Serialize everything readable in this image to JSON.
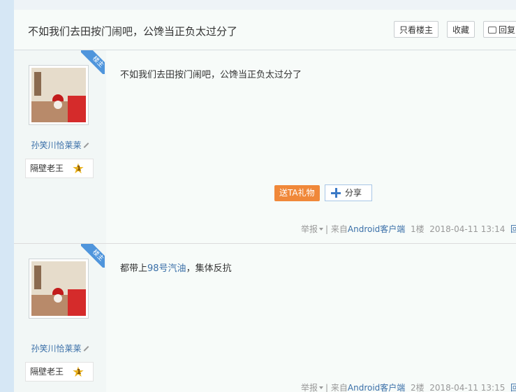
{
  "thread": {
    "title": "不如我们去田按门闹吧，公馋当正负太过分了",
    "only_op_label": "只看楼主",
    "favorite_label": "收藏",
    "reply_label": "回复"
  },
  "posts": [
    {
      "ribbon": "楼主",
      "username": "孙笑川恰莱莱",
      "badge_title": "隔壁老王",
      "badge_level": "1",
      "content": "不如我们去田按门闹吧，公馋当正负太过分了",
      "gift_label": "送TA礼物",
      "share_label": "分享",
      "report_label": "举报",
      "separator": "|",
      "source_prefix": "来自",
      "source_client": "Android客户端",
      "floor": "1楼",
      "time": "2018-04-11 13:14",
      "reply_label": "回复"
    },
    {
      "ribbon": "楼主",
      "username": "孙笑川恰莱莱",
      "badge_title": "隔壁老王",
      "badge_level": "1",
      "content_prefix": "都带上",
      "content_link": "98号汽油",
      "content_suffix": "，集体反抗",
      "report_label": "举报",
      "separator": "|",
      "source_prefix": "来自",
      "source_client": "Android客户端",
      "floor": "2楼",
      "time": "2018-04-11 13:15",
      "reply_label": "回复"
    }
  ]
}
